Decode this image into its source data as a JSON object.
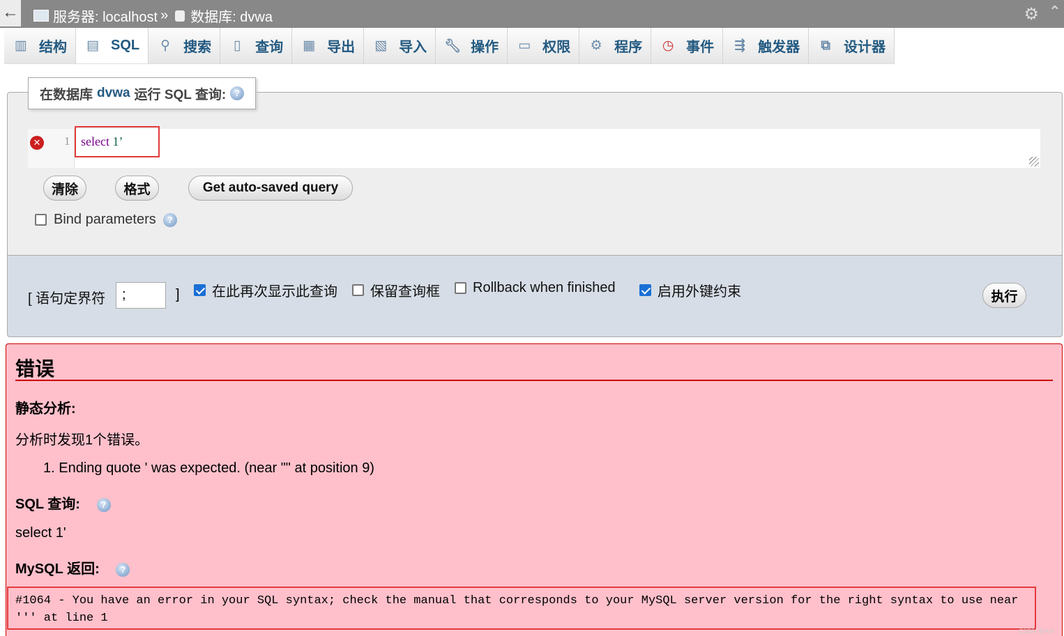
{
  "breadcrumb": {
    "back_icon": "arrow-left-icon",
    "server_label": "服务器: localhost",
    "separator": "»",
    "database_label": "数据库: dvwa"
  },
  "tabs": [
    {
      "label": "结构",
      "icon": "structure-icon",
      "active": false
    },
    {
      "label": "SQL",
      "icon": "sql-icon",
      "active": true
    },
    {
      "label": "搜索",
      "icon": "search-icon",
      "active": false
    },
    {
      "label": "查询",
      "icon": "query-icon",
      "active": false
    },
    {
      "label": "导出",
      "icon": "export-icon",
      "active": false
    },
    {
      "label": "导入",
      "icon": "import-icon",
      "active": false
    },
    {
      "label": "操作",
      "icon": "wrench-icon",
      "active": false
    },
    {
      "label": "权限",
      "icon": "privileges-icon",
      "active": false
    },
    {
      "label": "程序",
      "icon": "routines-icon",
      "active": false
    },
    {
      "label": "事件",
      "icon": "clock-icon",
      "active": false
    },
    {
      "label": "触发器",
      "icon": "triggers-icon",
      "active": false
    },
    {
      "label": "设计器",
      "icon": "designer-icon",
      "active": false
    }
  ],
  "query_panel": {
    "legend_prefix": "在数据库",
    "legend_db": "dvwa",
    "legend_suffix": "运行 SQL 查询:",
    "editor_line_number": "1",
    "editor_keyword": "select",
    "editor_rest": "1’",
    "clear_label": "清除",
    "format_label": "格式",
    "autosave_label": "Get auto-saved query",
    "bind_params_label": "Bind parameters",
    "bind_params_checked": false
  },
  "options": {
    "delimiter_label": "[ 语句定界符",
    "delimiter_value": ";",
    "delimiter_close": "]",
    "show_again_label": "在此再次显示此查询",
    "show_again_checked": true,
    "retain_box_label": "保留查询框",
    "retain_box_checked": false,
    "rollback_label": "Rollback when finished",
    "rollback_checked": false,
    "fk_checks_label": "启用外键约束",
    "fk_checks_checked": true,
    "go_label": "执行"
  },
  "error": {
    "title": "错误",
    "static_analysis_label": "静态分析:",
    "found_text": "分析时发现1个错误。",
    "errors": [
      "1. Ending quote ' was expected. (near \"\" at position 9)"
    ],
    "sql_query_label": "SQL 查询:",
    "sql_query": "select 1'",
    "mysql_said_label": "MySQL 返回:",
    "mysql_message": "#1064 - You have an error in your SQL syntax; check the manual that corresponds to your MySQL server version for the right syntax to use near ''' at line 1"
  },
  "watermark": "CSDN @Ar0",
  "colors": {
    "tab_text": "#235a81",
    "error_bg": "#ffc0cb",
    "error_rule": "#cc0000",
    "highlight_box": "#e23a3a",
    "topbar": "#888888"
  }
}
